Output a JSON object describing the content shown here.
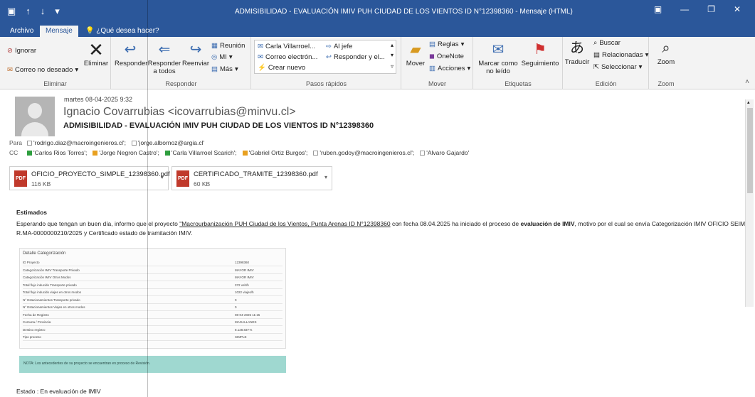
{
  "window": {
    "title": "ADMISIBILIDAD - EVALUACIÓN IMIV PUH CIUDAD DE LOS VIENTOS ID N°12398360 - Mensaje (HTML)"
  },
  "tabs": [
    "Archivo",
    "Mensaje",
    "¿Qué desea hacer?"
  ],
  "ribbon": {
    "eliminar": {
      "label": "Eliminar",
      "ignorar": "Ignorar",
      "no_deseado": "Correo no deseado",
      "eliminar_btn": "Eliminar"
    },
    "responder": {
      "label": "Responder",
      "responder": "Responder",
      "responder_todos_1": "Responder",
      "responder_todos_2": "a todos",
      "reenviar": "Reenviar",
      "reunion": "Reunión",
      "mi": "MI",
      "mas": "Más"
    },
    "pasos": {
      "label": "Pasos rápidos",
      "carla": "Carla Villarroel...",
      "al_jefe": "Al jefe",
      "correo": "Correo electrón...",
      "responder_el": "Responder y el...",
      "crear": "Crear nuevo"
    },
    "mover": {
      "label": "Mover",
      "mover": "Mover",
      "reglas": "Reglas",
      "onenote": "OneNote",
      "acciones": "Acciones"
    },
    "etiquetas": {
      "label": "Etiquetas",
      "marcar_1": "Marcar como",
      "marcar_2": "no leído",
      "seguimiento": "Seguimiento"
    },
    "edicion": {
      "label": "Edición",
      "traducir": "Traducir",
      "buscar": "Buscar",
      "relacionadas": "Relacionadas",
      "seleccionar": "Seleccionar"
    },
    "zoom": {
      "label": "Zoom",
      "zoom": "Zoom"
    }
  },
  "message": {
    "date": "martes 08-04-2025 9:32",
    "sender": "Ignacio Covarrubias <icovarrubias@minvu.cl>",
    "subject": "ADMISIBILIDAD - EVALUACIÓN IMIV PUH CIUDAD DE LOS VIENTOS ID N°12398360",
    "to_label": "Para",
    "to": [
      "'rodrigo.diaz@macroingenieros.cl';",
      "'jorge.albornoz@argia.cl'"
    ],
    "cc_label": "CC",
    "cc": [
      {
        "name": "'Carlos Rios Torres';",
        "color": "#2e9e3e"
      },
      {
        "name": "'Jorge Negron Castro';",
        "color": "#e8a020"
      },
      {
        "name": "'Carla Villarroel Scarich';",
        "color": "#2e9e3e"
      },
      {
        "name": "'Gabriel Ortiz Burgos';",
        "color": "#e8a020"
      },
      {
        "name": "'ruben.godoy@macroingenieros.cl';",
        "color": "#ffffff"
      },
      {
        "name": "'Alvaro Gajardo'",
        "color": "#ffffff"
      }
    ],
    "attachments": [
      {
        "name": "OFICIO_PROYECTO_SIMPLE_12398360.pdf",
        "size": "116 KB"
      },
      {
        "name": "CERTIFICADO_TRAMITE_12398360.pdf",
        "size": "60 KB"
      }
    ],
    "greeting": "Estimados",
    "body_1": "Esperando que tengan un buen día, informo que el proyecto ",
    "project_link": "\"Macrourbanización PUH Ciudad de los Vientos, Punta Arenas ID N°12398360",
    "body_2": " con fecha 08.04.2025 ha iniciado el proceso de ",
    "body_bold": "evaluación de IMIV",
    "body_3": ", motivo por el cual se envía Categorización IMIV OFICIO SEIM N°",
    "body_line2": "R.MA-0000000210/2025 y Certificado estado de tramitación IMIV.",
    "table": {
      "title": "Detalle Categorización",
      "rows": [
        {
          "k": "ID Proyecto",
          "v": "12398360"
        },
        {
          "k": "Categorización IMIV Transporte Privado",
          "v": "MAYOR IMIV"
        },
        {
          "k": "Categorización IMIV Otros Modos",
          "v": "MAYOR IMIV"
        },
        {
          "k": "Total flujo inducido Transporte privado",
          "v": "372 veh/h"
        },
        {
          "k": "Total flujo inducido viajes en otros modos",
          "v": "1022 viajes/h"
        },
        {
          "k": "N° Estacionamientos Transporte privado",
          "v": "0"
        },
        {
          "k": "N° Estacionamientos Viajes en otros modos",
          "v": "0"
        },
        {
          "k": "Fecha de Registro",
          "v": "08-04-2025 11:15"
        },
        {
          "k": "Comuna / Provincia",
          "v": "MAGALLANES"
        },
        {
          "k": "Destino registro",
          "v": "8.128.837-K"
        },
        {
          "k": "Tipo proceso",
          "v": "SIMPLE"
        }
      ]
    },
    "note": "NOTA: Los antecedentes de su proyecto se encuentran en proceso de Revisión.",
    "estado": "Estado : En evaluación de IMIV"
  }
}
